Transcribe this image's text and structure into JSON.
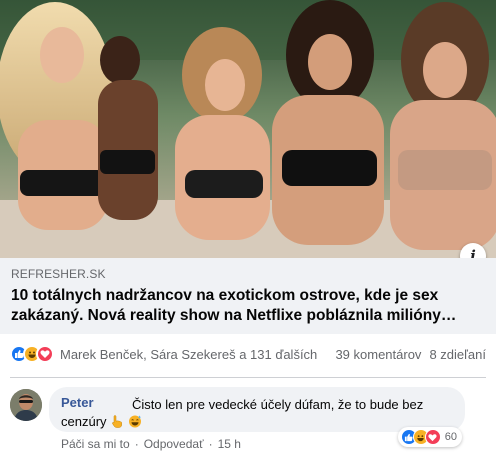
{
  "post": {
    "link": {
      "domain": "REFRESHER.SK",
      "headline": "10 totálnych nadržancov na exotickom ostrove, kde je sex zakázaný. Nová reality show na Netflixe pobláznila milióny…"
    },
    "reactions": {
      "types": [
        "like-icon",
        "haha-icon",
        "love-icon"
      ],
      "names": "Marek Benček, Sára Szekereš a 131 ďalších",
      "comments": "39 komentárov",
      "shares": "8 zdieľaní"
    },
    "colors": {
      "like": "#1877f2",
      "haha": "#f7b125",
      "love": "#f33e58",
      "author": "#385898"
    }
  },
  "comment": {
    "author": "Peter",
    "text_line1": "Čisto len pre vedecké účely dúfam, že to bude bez",
    "text_line2": "cenzúry",
    "emojis": [
      "pointing-hand-icon",
      "grinning-sweat-icon"
    ],
    "reaction_count": "60",
    "actions": {
      "like": "Páči sa mi to",
      "reply": "Odpovedať",
      "time": "15 h",
      "separator": "·"
    }
  }
}
